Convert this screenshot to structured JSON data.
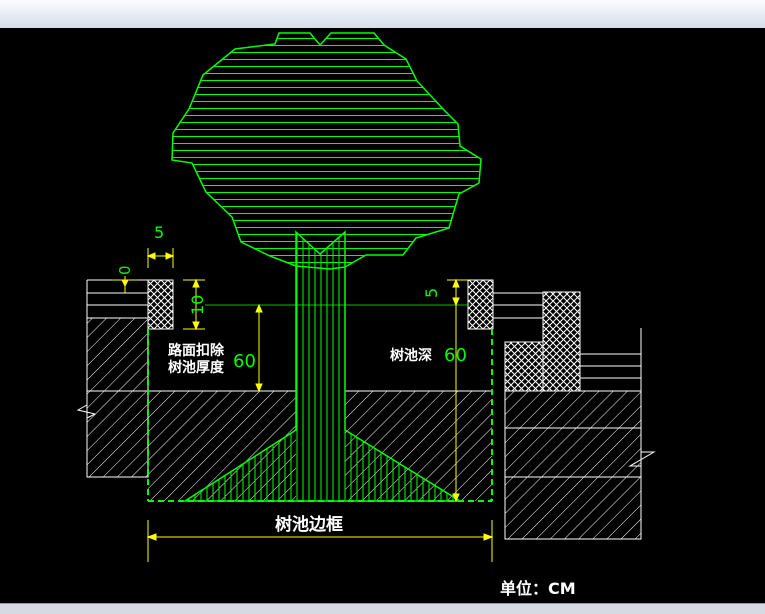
{
  "drawing": {
    "unit_label": "单位：CM",
    "labels": {
      "pavement_deduct_line1": "路面扣除",
      "pavement_deduct_line2": "树池厚度",
      "pit_depth": "树池深",
      "pit_frame": "树池边框"
    },
    "dimensions": {
      "frame_width_left": "5",
      "frame_offset_left": "0",
      "frame_height_left": "10",
      "frame_height_right": "5",
      "deduct_depth": "60",
      "pit_depth": "60"
    },
    "colors": {
      "background": "#000000",
      "tree": "#00ff00",
      "dimension": "#ffff00",
      "dimension_text": "#00ff00",
      "structure": "#ffffff",
      "pit_outline": "#00ff00"
    }
  }
}
